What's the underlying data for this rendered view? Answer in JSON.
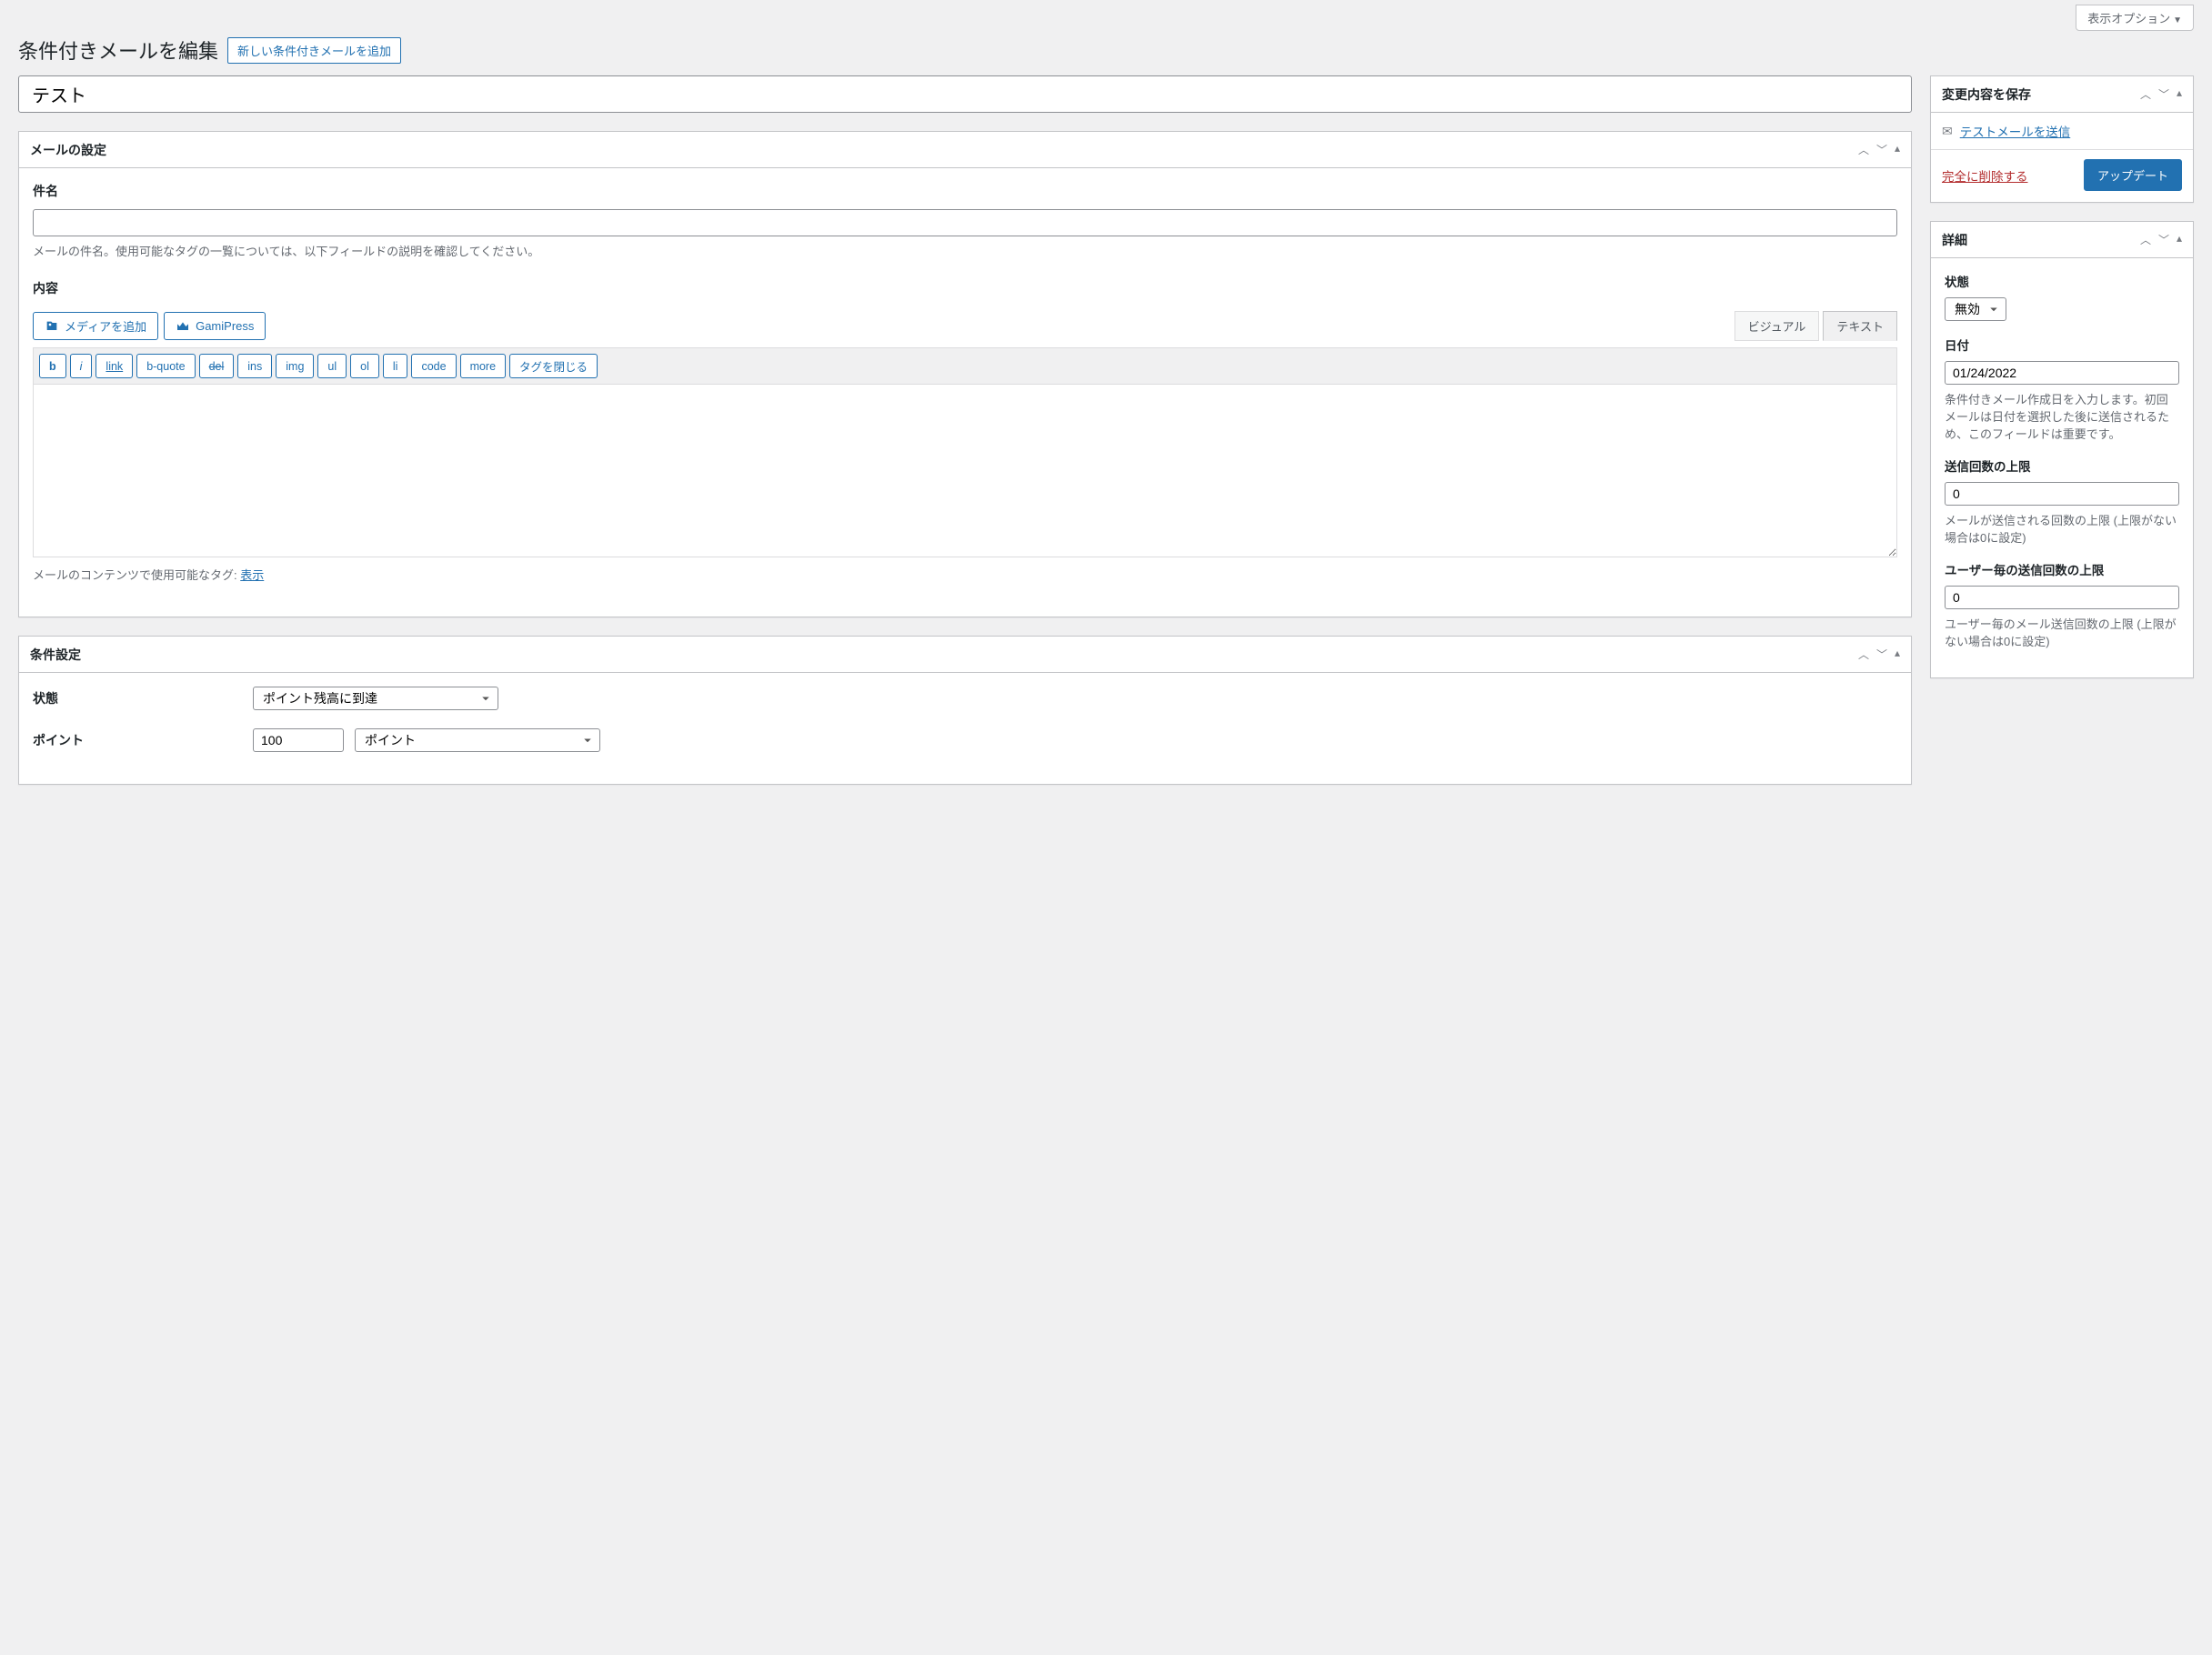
{
  "top": {
    "screen_options": "表示オプション"
  },
  "header": {
    "title": "条件付きメールを編集",
    "add_new": "新しい条件付きメールを追加"
  },
  "post_title": "テスト",
  "mail_settings": {
    "panel_title": "メールの設定",
    "subject": {
      "label": "件名",
      "value": "",
      "desc": "メールの件名。使用可能なタグの一覧については、以下フィールドの説明を確認してください。"
    },
    "content": {
      "label": "内容",
      "add_media": "メディアを追加",
      "gami": "GamiPress",
      "tab_visual": "ビジュアル",
      "tab_text": "テキスト",
      "qt": [
        "b",
        "i",
        "link",
        "b-quote",
        "del",
        "ins",
        "img",
        "ul",
        "ol",
        "li",
        "code",
        "more",
        "タグを閉じる"
      ],
      "footer_pre": "メールのコンテンツで使用可能なタグ: ",
      "footer_link": "表示"
    }
  },
  "conditions": {
    "panel_title": "条件設定",
    "status": {
      "label": "状態",
      "value": "ポイント残高に到達"
    },
    "points": {
      "label": "ポイント",
      "num": "100",
      "type": "ポイント"
    }
  },
  "save_box": {
    "panel_title": "変更内容を保存",
    "test_link": "テストメールを送信",
    "delete_link": "完全に削除する",
    "update": "アップデート"
  },
  "details": {
    "panel_title": "詳細",
    "status": {
      "label": "状態",
      "value": "無効"
    },
    "date": {
      "label": "日付",
      "value": "01/24/2022",
      "desc": "条件付きメール作成日を入力します。初回メールは日付を選択した後に送信されるため、このフィールドは重要です。"
    },
    "send_limit": {
      "label": "送信回数の上限",
      "value": "0",
      "desc": "メールが送信される回数の上限 (上限がない場合は0に設定)"
    },
    "user_limit": {
      "label": "ユーザー毎の送信回数の上限",
      "value": "0",
      "desc": "ユーザー毎のメール送信回数の上限 (上限がない場合は0に設定)"
    }
  }
}
